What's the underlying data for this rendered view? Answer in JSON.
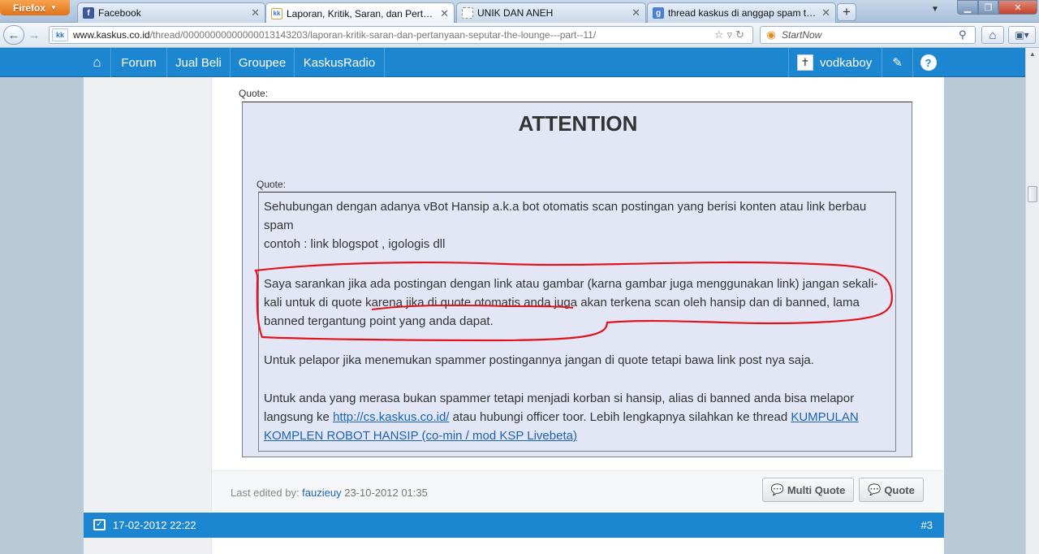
{
  "browser": {
    "menu_button": "Firefox",
    "tabs": [
      {
        "title": "Facebook",
        "favicon": "f",
        "color": "#3b5998"
      },
      {
        "title": "Laporan, Kritik, Saran, dan Pertanyaa...",
        "favicon": "kk",
        "color": "#2a76c6"
      },
      {
        "title": "UNIK DAN ANEH",
        "favicon": "",
        "color": "#ffffff"
      },
      {
        "title": "thread kaskus di anggap spam terus -...",
        "favicon": "g",
        "color": "#4a7fd6"
      }
    ],
    "url_host": "www.kaskus.co.id",
    "url_path": "/thread/00000000000000013143203/laporan-kritik-saran-dan-pertanyaan-seputar-the-lounge---part--11/",
    "search_placeholder": "StartNow"
  },
  "header": {
    "nav": [
      "Forum",
      "Jual Beli",
      "Groupee",
      "KaskusRadio"
    ],
    "username": "vodkaboy"
  },
  "post": {
    "quote_label": "Quote:",
    "attention": "ATTENTION",
    "inner_quote_label": "Quote:",
    "p1": "Sehubungan dengan adanya vBot Hansip a.k.a bot otomatis scan postingan yang berisi konten atau link berbau spam",
    "p1b": "contoh : link blogspot , igologis dll",
    "p2": "Saya sarankan jika ada postingan dengan link atau gambar (karna gambar juga menggunakan link) jangan sekali-kali untuk di quote karena jika di quote otomatis anda juga akan terkena scan oleh hansip dan di banned, lama banned tergantung point yang anda dapat.",
    "p3": "Untuk pelapor jika menemukan spammer postingannya jangan di quote tetapi bawa link post nya saja.",
    "p4_a": "Untuk anda yang merasa bukan spammer tetapi menjadi korban si hansip, alias di banned anda bisa melapor langsung ke ",
    "p4_link": "http://cs.kaskus.co.id/",
    "p4_b": " atau hubungi officer toor. Lebih lengkapnya silahkan ke thread ",
    "p4_link2": "KUMPULAN KOMPLEN ROBOT HANSIP (co-min / mod KSP Livebeta)",
    "edited_label": "Last edited by: ",
    "edited_by": "fauzieuy",
    "edited_date": "23-10-2012 01:35",
    "multi_quote": "Multi Quote",
    "quote": "Quote"
  },
  "next_post": {
    "date": "17-02-2012 22:22",
    "number": "#3"
  }
}
